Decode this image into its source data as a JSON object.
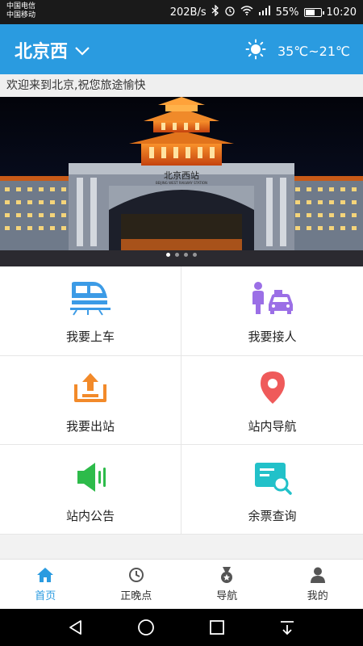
{
  "status_bar": {
    "carrier_1": "中国电信",
    "carrier_2": "中国移动",
    "net_speed": "202B/s",
    "battery": "55%",
    "time": "10:20"
  },
  "header": {
    "city": "北京西",
    "temperature": "35℃~21℃"
  },
  "welcome": "欢迎来到北京,祝您旅途愉快",
  "banner": {
    "sign": "北京西站",
    "sign_en": "BEIJING WEST RAILWAY STATION",
    "slide_count": 4,
    "active_slide": 1
  },
  "menu": [
    {
      "label": "我要上车",
      "icon": "train-icon",
      "color": "#3c9be6"
    },
    {
      "label": "我要接人",
      "icon": "pickup-person-car-icon",
      "color": "#9b6fe6"
    },
    {
      "label": "我要出站",
      "icon": "exit-station-icon",
      "color": "#f28a2a"
    },
    {
      "label": "站内导航",
      "icon": "location-pin-icon",
      "color": "#ef5a5a"
    },
    {
      "label": "站内公告",
      "icon": "speaker-icon",
      "color": "#2dbb4a"
    },
    {
      "label": "余票查询",
      "icon": "ticket-search-icon",
      "color": "#22c1c9"
    }
  ],
  "tabs": [
    {
      "label": "首页",
      "icon": "home-icon",
      "active": true
    },
    {
      "label": "正晚点",
      "icon": "clock-icon",
      "active": false
    },
    {
      "label": "导航",
      "icon": "medal-icon",
      "active": false
    },
    {
      "label": "我的",
      "icon": "user-icon",
      "active": false
    }
  ],
  "colors": {
    "primary": "#2a9be0",
    "background": "#f2f2f2"
  }
}
